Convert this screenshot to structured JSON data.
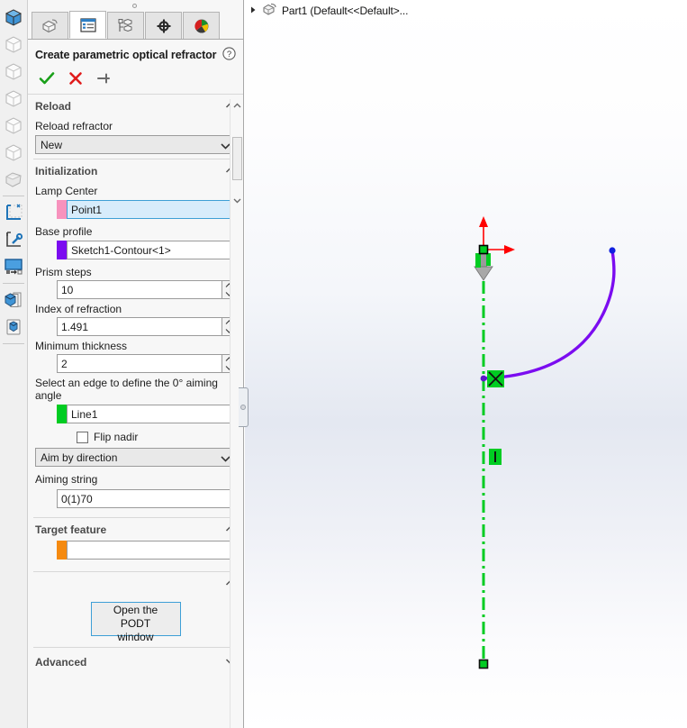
{
  "app": {
    "tree_root_label": "Part1  (Default<<Default>...",
    "tree_root_icon": "part-icon",
    "tree_expand_icon": "expand-arrow-icon"
  },
  "rail": {
    "items": [
      {
        "name": "view-orientation-isometric",
        "icon": "cube-solid-icon",
        "active": true
      },
      {
        "name": "view-orientation-front",
        "icon": "cube-wire-icon",
        "active": false
      },
      {
        "name": "view-orientation-back",
        "icon": "cube-wire-icon",
        "active": false
      },
      {
        "name": "view-orientation-left",
        "icon": "cube-wire-icon",
        "active": false
      },
      {
        "name": "view-orientation-right",
        "icon": "cube-wire-icon",
        "active": false
      },
      {
        "name": "view-orientation-top",
        "icon": "cube-wire-icon",
        "active": false
      },
      {
        "name": "view-orientation-bottom",
        "icon": "cube-shaded-icon",
        "active": false
      },
      {
        "name": "sketch-tool",
        "icon": "sketch-grid-icon",
        "active": false
      },
      {
        "name": "edit-sketch-tool",
        "icon": "sketch-wrench-icon",
        "active": false
      },
      {
        "name": "section-view-tool",
        "icon": "screen-arrow-icon",
        "active": false
      },
      {
        "name": "appearance-tool",
        "icon": "cube-pages-icon",
        "active": false
      },
      {
        "name": "scene-tool",
        "icon": "scene-box-icon",
        "active": false
      }
    ]
  },
  "property_manager": {
    "tabs": [
      {
        "name": "tab-feature-manager",
        "icon": "feature-tree-icon",
        "active": false
      },
      {
        "name": "tab-property-manager",
        "icon": "property-list-icon",
        "active": true
      },
      {
        "name": "tab-configuration-manager",
        "icon": "configuration-icon",
        "active": false
      },
      {
        "name": "tab-dimxpert-manager",
        "icon": "dimxpert-target-icon",
        "active": false
      },
      {
        "name": "tab-display-manager",
        "icon": "display-sphere-icon",
        "active": false
      }
    ],
    "title": "Create parametric optical refractor",
    "help_icon": "help-question-icon",
    "actions": {
      "ok": {
        "label": "OK",
        "icon": "checkmark-icon",
        "color": "#1aa01a"
      },
      "cancel": {
        "label": "Cancel",
        "icon": "cross-icon",
        "color": "#e01b1b"
      },
      "pin": {
        "label": "Keep Visible",
        "icon": "pushpin-icon",
        "color": "#6a6a6a"
      }
    },
    "sections": {
      "reload": {
        "header": "Reload",
        "collapse_icon": "chevron-up-icon",
        "refractor_label": "Reload refractor",
        "refractor_value": "New",
        "refractor_options": [
          "New"
        ],
        "dropdown_icon": "chevron-down-icon"
      },
      "initialization": {
        "header": "Initialization",
        "collapse_icon": "chevron-up-icon",
        "lamp_center_label": "Lamp Center",
        "lamp_center_value": "Point1",
        "lamp_center_swatch": "#f792bd",
        "base_profile_label": "Base profile",
        "base_profile_value": "Sketch1-Contour<1>",
        "base_profile_swatch": "#7b0cf0",
        "prism_steps_label": "Prism steps",
        "prism_steps_value": "10",
        "index_refraction_label": "Index of refraction",
        "index_refraction_value": "1.491",
        "min_thickness_label": "Minimum thickness",
        "min_thickness_value": "2",
        "edge_select_label": "Select an edge to define the 0° aiming angle",
        "edge_value": "Line1",
        "edge_swatch": "#00cc22",
        "flip_nadir_label": "Flip nadir",
        "flip_nadir_checked": false,
        "aim_mode_value": "Aim by direction",
        "aim_mode_options": [
          "Aim by direction"
        ],
        "aiming_string_label": "Aiming string",
        "aiming_string_value": "0(1)70"
      },
      "target_feature": {
        "header": "Target feature",
        "collapse_icon": "chevron-up-icon",
        "value": "",
        "placeholder": "",
        "swatch": "#f58a10"
      },
      "podt": {
        "collapse_icon": "chevron-up-icon",
        "button_label_line1": "Open the PODT",
        "button_label_line2": "window"
      },
      "advanced": {
        "header": "Advanced",
        "collapse_icon": "chevron-down-icon"
      }
    },
    "scrollbar": {
      "up_icon": "scroll-up-arrow-icon",
      "down_icon": "scroll-down-arrow-icon"
    },
    "splitter": {
      "name": "panel-splitter-handle",
      "icon": "grip-dot-icon"
    }
  },
  "viewport": {
    "origin": {
      "x_axis_color": "#ff0000",
      "y_axis_color": "#ff0000",
      "marker_color": "#00cc22"
    },
    "centerline_color": "#00cc22",
    "spline_color": "#7b0cf0",
    "endpoint_color": "#1020e0",
    "direction_arrow_color": "#9a9a9a",
    "relations": [
      {
        "name": "pierce-relation-badge",
        "color": "#00cc22"
      },
      {
        "name": "vertical-relation-badge",
        "color": "#00cc22"
      }
    ]
  }
}
